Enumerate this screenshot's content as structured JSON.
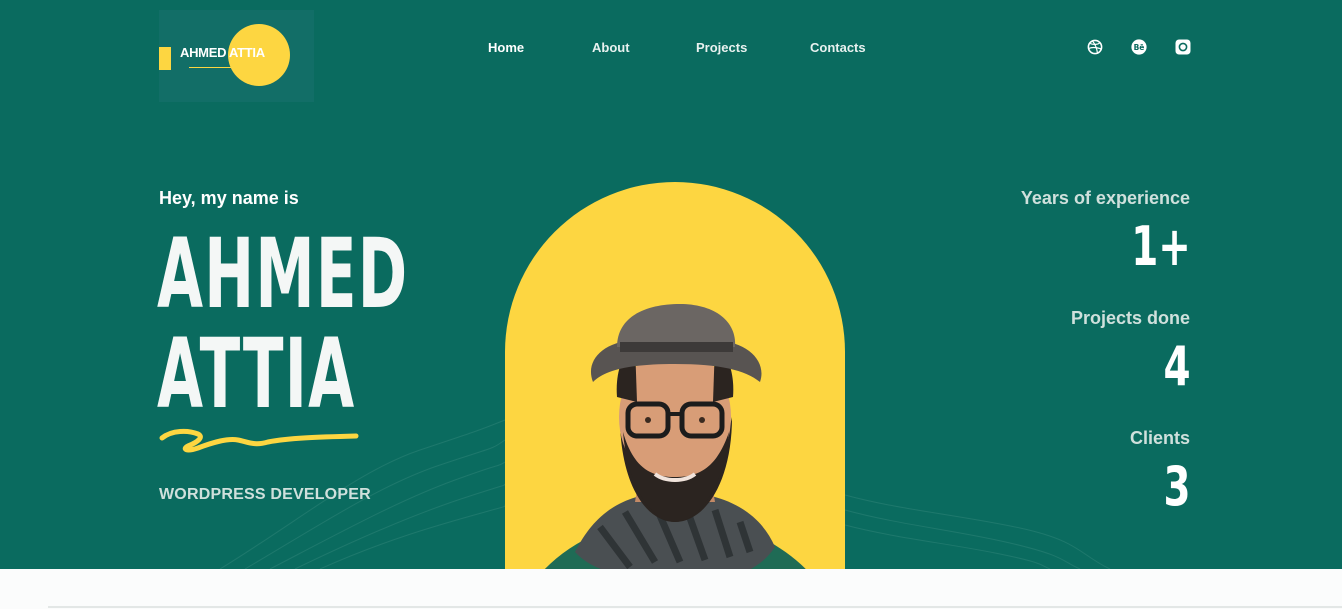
{
  "brand": {
    "logo_text": "AHMED ATTIA"
  },
  "nav": {
    "items": [
      {
        "label": "Home",
        "active": true
      },
      {
        "label": "About",
        "active": false
      },
      {
        "label": "Projects",
        "active": false
      },
      {
        "label": "Contacts",
        "active": false
      }
    ]
  },
  "social": [
    "dribbble-icon",
    "behance-icon",
    "instagram-icon"
  ],
  "hero": {
    "greeting": "Hey, my name is",
    "first_name": "AHMED",
    "last_name": "ATTIA",
    "role": "WORDPRESS DEVELOPER"
  },
  "stats": [
    {
      "label": "Years of experience",
      "value": "1+"
    },
    {
      "label": "Projects done",
      "value": "4"
    },
    {
      "label": "Clients",
      "value": "3"
    }
  ],
  "colors": {
    "primary": "#0a6b5f",
    "accent": "#fdd641",
    "text": "#ffffff",
    "muted": "#cfe0dc"
  }
}
